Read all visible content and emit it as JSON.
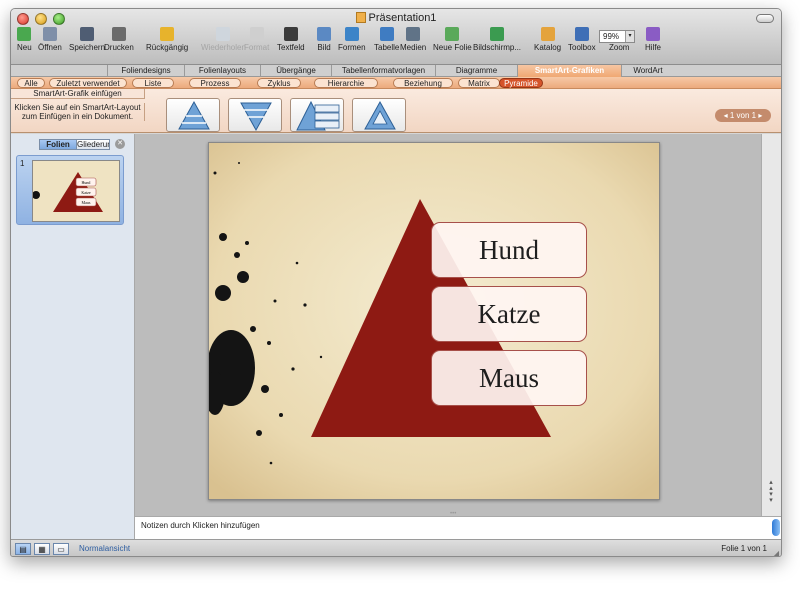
{
  "window": {
    "title": "Präsentation1"
  },
  "toolbar": [
    {
      "label": "Neu",
      "icon": "new-doc-icon",
      "color": "#4aa84f",
      "disabled": false
    },
    {
      "label": "Öffnen",
      "icon": "open-folder-icon",
      "color": "#7f8fa8",
      "disabled": false
    },
    {
      "label": "Speichern",
      "icon": "save-disk-icon",
      "color": "#4f5d73",
      "disabled": false
    },
    {
      "label": "Drucken",
      "icon": "print-icon",
      "color": "#6b6b6b",
      "disabled": false
    },
    {
      "label": "Rückgängig",
      "icon": "undo-icon",
      "color": "#e7b32c",
      "disabled": false
    },
    {
      "label": "Wiederholen",
      "icon": "redo-icon",
      "color": "#cfd6dd",
      "disabled": true
    },
    {
      "label": "Format",
      "icon": "format-brush-icon",
      "color": "#cfcfcf",
      "disabled": true
    },
    {
      "label": "Textfeld",
      "icon": "textbox-icon",
      "color": "#3b3b3b",
      "disabled": false
    },
    {
      "label": "Bild",
      "icon": "picture-icon",
      "color": "#5b89c3",
      "disabled": false
    },
    {
      "label": "Formen",
      "icon": "shapes-icon",
      "color": "#3c84c8",
      "disabled": false
    },
    {
      "label": "Tabelle",
      "icon": "table-icon",
      "color": "#3f7cc2",
      "disabled": false
    },
    {
      "label": "Medien",
      "icon": "media-icon",
      "color": "#607387",
      "disabled": false
    },
    {
      "label": "Neue Folie",
      "icon": "new-slide-icon",
      "color": "#5aa95a",
      "disabled": false
    },
    {
      "label": "Bildschirmp...",
      "icon": "slideshow-icon",
      "color": "#3b9b50",
      "disabled": false
    },
    {
      "label": "Katalog",
      "icon": "gallery-icon",
      "color": "#e4a33c",
      "disabled": false
    },
    {
      "label": "Toolbox",
      "icon": "toolbox-icon",
      "color": "#3f6fb6",
      "disabled": false
    },
    {
      "label": "Zoom",
      "icon": "zoom-icon",
      "color": "#ffffff",
      "disabled": false
    },
    {
      "label": "Hilfe",
      "icon": "help-icon",
      "color": "#8a5cc4",
      "disabled": false
    }
  ],
  "zoom_value": "99%",
  "ribbon_tabs": [
    {
      "label": "Foliendesigns",
      "active": false
    },
    {
      "label": "Folienlayouts",
      "active": false
    },
    {
      "label": "Übergänge",
      "active": false
    },
    {
      "label": "Tabellenformatvorlagen",
      "active": false
    },
    {
      "label": "Diagramme",
      "active": false
    },
    {
      "label": "SmartArt-Grafiken",
      "active": true
    },
    {
      "label": "WordArt",
      "active": false
    }
  ],
  "gallery_categories": [
    {
      "label": "Alle",
      "active": false
    },
    {
      "label": "Zuletzt verwendet",
      "active": false
    },
    {
      "label": "Liste",
      "active": false
    },
    {
      "label": "Prozess",
      "active": false
    },
    {
      "label": "Zyklus",
      "active": false
    },
    {
      "label": "Hierarchie",
      "active": false
    },
    {
      "label": "Beziehung",
      "active": false
    },
    {
      "label": "Matrix",
      "active": false
    },
    {
      "label": "Pyramide",
      "active": true
    }
  ],
  "smartart_panel": {
    "heading": "SmartArt-Grafik einfügen",
    "description": "Klicken Sie auf ein SmartArt-Layout zum Einfügen in ein Dokument.",
    "thumbnails": [
      {
        "icon": "pyramid-layout-icon"
      },
      {
        "icon": "inverted-pyramid-layout-icon"
      },
      {
        "icon": "pyramid-list-layout-icon"
      },
      {
        "icon": "segmented-pyramid-layout-icon"
      }
    ],
    "pager": "1 von 1"
  },
  "sidebar": {
    "tabs": [
      {
        "label": "Folien",
        "active": true
      },
      {
        "label": "Gliederung",
        "active": false
      }
    ],
    "slide_number": "1"
  },
  "slide": {
    "items": [
      "Hund",
      "Katze",
      "Maus"
    ],
    "triangle_color": "#8e1a13"
  },
  "notes_placeholder": "Notizen durch Klicken hinzufügen",
  "status": {
    "view_label": "Normalansicht",
    "slide_info": "Folie 1 von 1"
  }
}
